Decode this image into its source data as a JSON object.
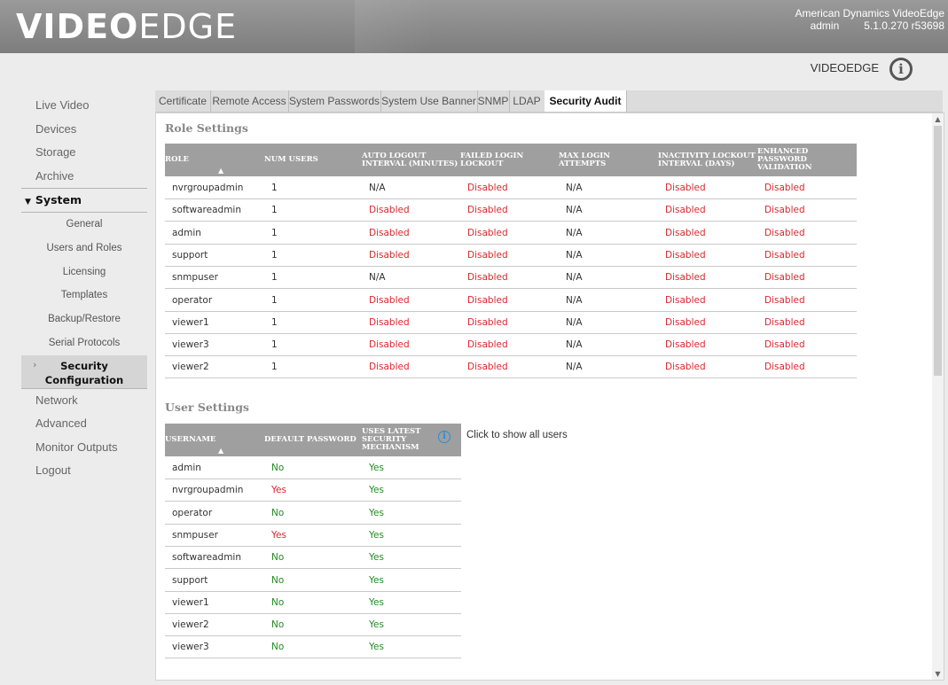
{
  "header": {
    "logo_bold": "VIDEO",
    "logo_light": "EDGE",
    "product": "American Dynamics VideoEdge",
    "user": "admin",
    "version": "5.1.0.270 r53698"
  },
  "subheader": {
    "brand": "VIDEOEDGE",
    "info_icon": "info-circle-icon"
  },
  "sidebar": {
    "items_top": [
      "Live Video",
      "Devices",
      "Storage",
      "Archive"
    ],
    "system_label": "System",
    "system_sub": [
      "General",
      "Users and Roles",
      "Licensing",
      "Templates",
      "Backup/Restore",
      "Serial Protocols"
    ],
    "active_sub_line1": "Security",
    "active_sub_line2": "Configuration",
    "items_bottom": [
      "Network",
      "Advanced",
      "Monitor Outputs",
      "Logout"
    ]
  },
  "tabs": [
    "Certificate",
    "Remote Access",
    "System Passwords",
    "System Use Banner",
    "SNMP",
    "LDAP",
    "Security Audit"
  ],
  "active_tab": "Security Audit",
  "role_settings": {
    "title": "Role Settings",
    "columns": [
      [
        "ROLE"
      ],
      [
        "NUM USERS"
      ],
      [
        "AUTO LOGOUT",
        "INTERVAL (MINUTES)"
      ],
      [
        "FAILED LOGIN",
        "LOCKOUT"
      ],
      [
        "MAX LOGIN ATTEMPTS"
      ],
      [
        "INACTIVITY LOCKOUT",
        "INTERVAL (DAYS)"
      ],
      [
        "ENHANCED",
        "PASSWORD",
        "VALIDATION"
      ]
    ],
    "rows": [
      [
        "nvrgroupadmin",
        "1",
        "N/A",
        "Disabled",
        "N/A",
        "Disabled",
        "Disabled"
      ],
      [
        "softwareadmin",
        "1",
        "Disabled",
        "Disabled",
        "N/A",
        "Disabled",
        "Disabled"
      ],
      [
        "admin",
        "1",
        "Disabled",
        "Disabled",
        "N/A",
        "Disabled",
        "Disabled"
      ],
      [
        "support",
        "1",
        "Disabled",
        "Disabled",
        "N/A",
        "Disabled",
        "Disabled"
      ],
      [
        "snmpuser",
        "1",
        "N/A",
        "Disabled",
        "N/A",
        "Disabled",
        "Disabled"
      ],
      [
        "operator",
        "1",
        "Disabled",
        "Disabled",
        "N/A",
        "Disabled",
        "Disabled"
      ],
      [
        "viewer1",
        "1",
        "Disabled",
        "Disabled",
        "N/A",
        "Disabled",
        "Disabled"
      ],
      [
        "viewer3",
        "1",
        "Disabled",
        "Disabled",
        "N/A",
        "Disabled",
        "Disabled"
      ],
      [
        "viewer2",
        "1",
        "Disabled",
        "Disabled",
        "N/A",
        "Disabled",
        "Disabled"
      ]
    ]
  },
  "user_settings": {
    "title": "User Settings",
    "columns": [
      [
        "USERNAME"
      ],
      [
        "DEFAULT PASSWORD"
      ],
      [
        "USES LATEST",
        "SECURITY",
        "MECHANISM"
      ]
    ],
    "show_all": "Click to show all users",
    "rows": [
      [
        "admin",
        "No",
        "Yes"
      ],
      [
        "nvrgroupadmin",
        "Yes",
        "Yes"
      ],
      [
        "operator",
        "No",
        "Yes"
      ],
      [
        "snmpuser",
        "Yes",
        "Yes"
      ],
      [
        "softwareadmin",
        "No",
        "Yes"
      ],
      [
        "support",
        "No",
        "Yes"
      ],
      [
        "viewer1",
        "No",
        "Yes"
      ],
      [
        "viewer2",
        "No",
        "Yes"
      ],
      [
        "viewer3",
        "No",
        "Yes"
      ]
    ]
  },
  "colors": {
    "disabled": "#d9282f",
    "no": "#228b22",
    "yes_default_pw": "#d9282f",
    "yes": "#228b22",
    "header_bg": "#8c8c8c",
    "table_head": "#9f9f9f"
  }
}
